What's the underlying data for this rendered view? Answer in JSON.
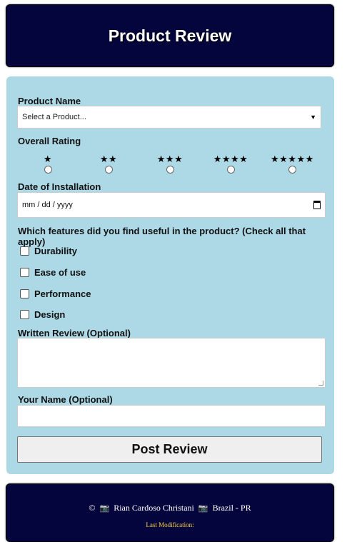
{
  "header": {
    "title": "Product Review"
  },
  "form": {
    "product_name_label": "Product Name",
    "product_select_value": "Select a Product...",
    "rating_label": "Overall Rating",
    "rating_options": [
      "★",
      "★★",
      "★★★",
      "★★★★",
      "★★★★★"
    ],
    "date_label": "Date of Installation",
    "date_placeholder": "mm / dd / yyyy",
    "features_question": "Which features did you find useful in the product? (Check all that apply)",
    "features": [
      "Durability",
      "Ease of use",
      "Performance",
      "Design"
    ],
    "review_label": "Written Review (Optional)",
    "name_label": "Your Name (Optional)",
    "submit_label": "Post Review"
  },
  "footer": {
    "copyright_symbol": "©",
    "author": "Rian Cardoso Christani",
    "location": "Brazil - PR",
    "last_modification_label": "Last Modification:"
  },
  "icons": {
    "camera": "camera-icon",
    "chevron": "chevron-down-icon",
    "calendar": "calendar-icon"
  }
}
